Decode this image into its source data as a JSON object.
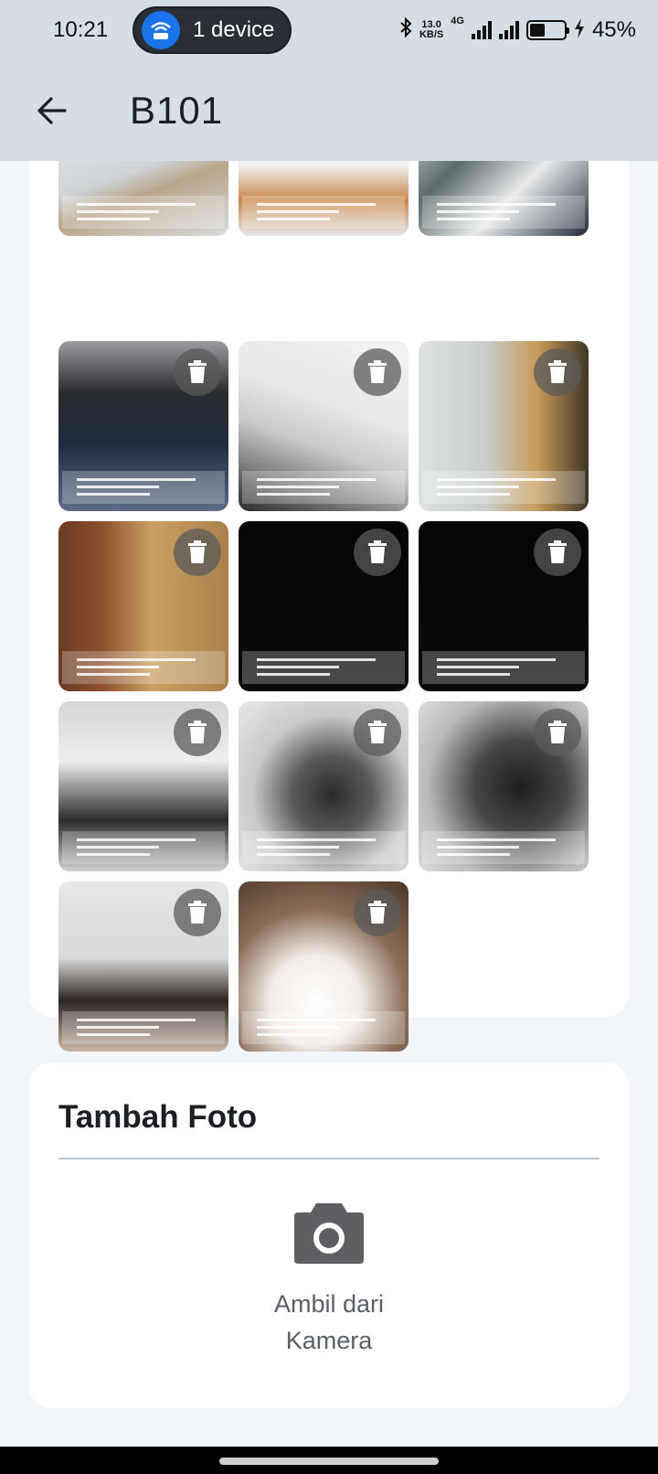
{
  "status_bar": {
    "time": "10:21",
    "hotspot_label": "1 device",
    "net_speed_value": "13.0",
    "net_speed_unit": "KB/S",
    "network_type": "4G",
    "battery_percent": "45%",
    "battery_level": 0.45
  },
  "app_bar": {
    "title": "B101",
    "back_icon": "arrow-left-icon"
  },
  "photos": [
    {
      "id": "photo-1",
      "style": "jar-marble",
      "partial": true
    },
    {
      "id": "photo-2",
      "style": "jar-marble-2",
      "partial": true
    },
    {
      "id": "photo-3",
      "style": "office-window",
      "partial": true
    },
    {
      "id": "photo-4",
      "style": "monitor-desk",
      "delete_icon": "trash-icon"
    },
    {
      "id": "photo-5",
      "style": "white-surface-cable",
      "delete_icon": "trash-icon"
    },
    {
      "id": "photo-6",
      "style": "wall-panel",
      "delete_icon": "trash-icon"
    },
    {
      "id": "photo-7",
      "style": "curtain-wall",
      "delete_icon": "trash-icon"
    },
    {
      "id": "photo-8",
      "style": "dark",
      "delete_icon": "trash-icon"
    },
    {
      "id": "photo-9",
      "style": "dark",
      "delete_icon": "trash-icon"
    },
    {
      "id": "photo-10",
      "style": "marble-charger",
      "delete_icon": "trash-icon"
    },
    {
      "id": "photo-11",
      "style": "blurry-cable",
      "delete_icon": "trash-icon"
    },
    {
      "id": "photo-12",
      "style": "blurry-cable-2",
      "delete_icon": "trash-icon"
    },
    {
      "id": "photo-13",
      "style": "person",
      "delete_icon": "trash-icon"
    },
    {
      "id": "photo-14",
      "style": "face-bright",
      "delete_icon": "trash-icon"
    }
  ],
  "add_photo": {
    "title": "Tambah Foto",
    "camera_icon": "camera-icon",
    "camera_label_line1": "Ambil dari",
    "camera_label_line2": "Kamera"
  },
  "colors": {
    "app_bar_bg": "#d5dde5",
    "page_bg": "#f2f5f9",
    "card_bg": "#ffffff",
    "hotspot_blue": "#1a73e8"
  }
}
